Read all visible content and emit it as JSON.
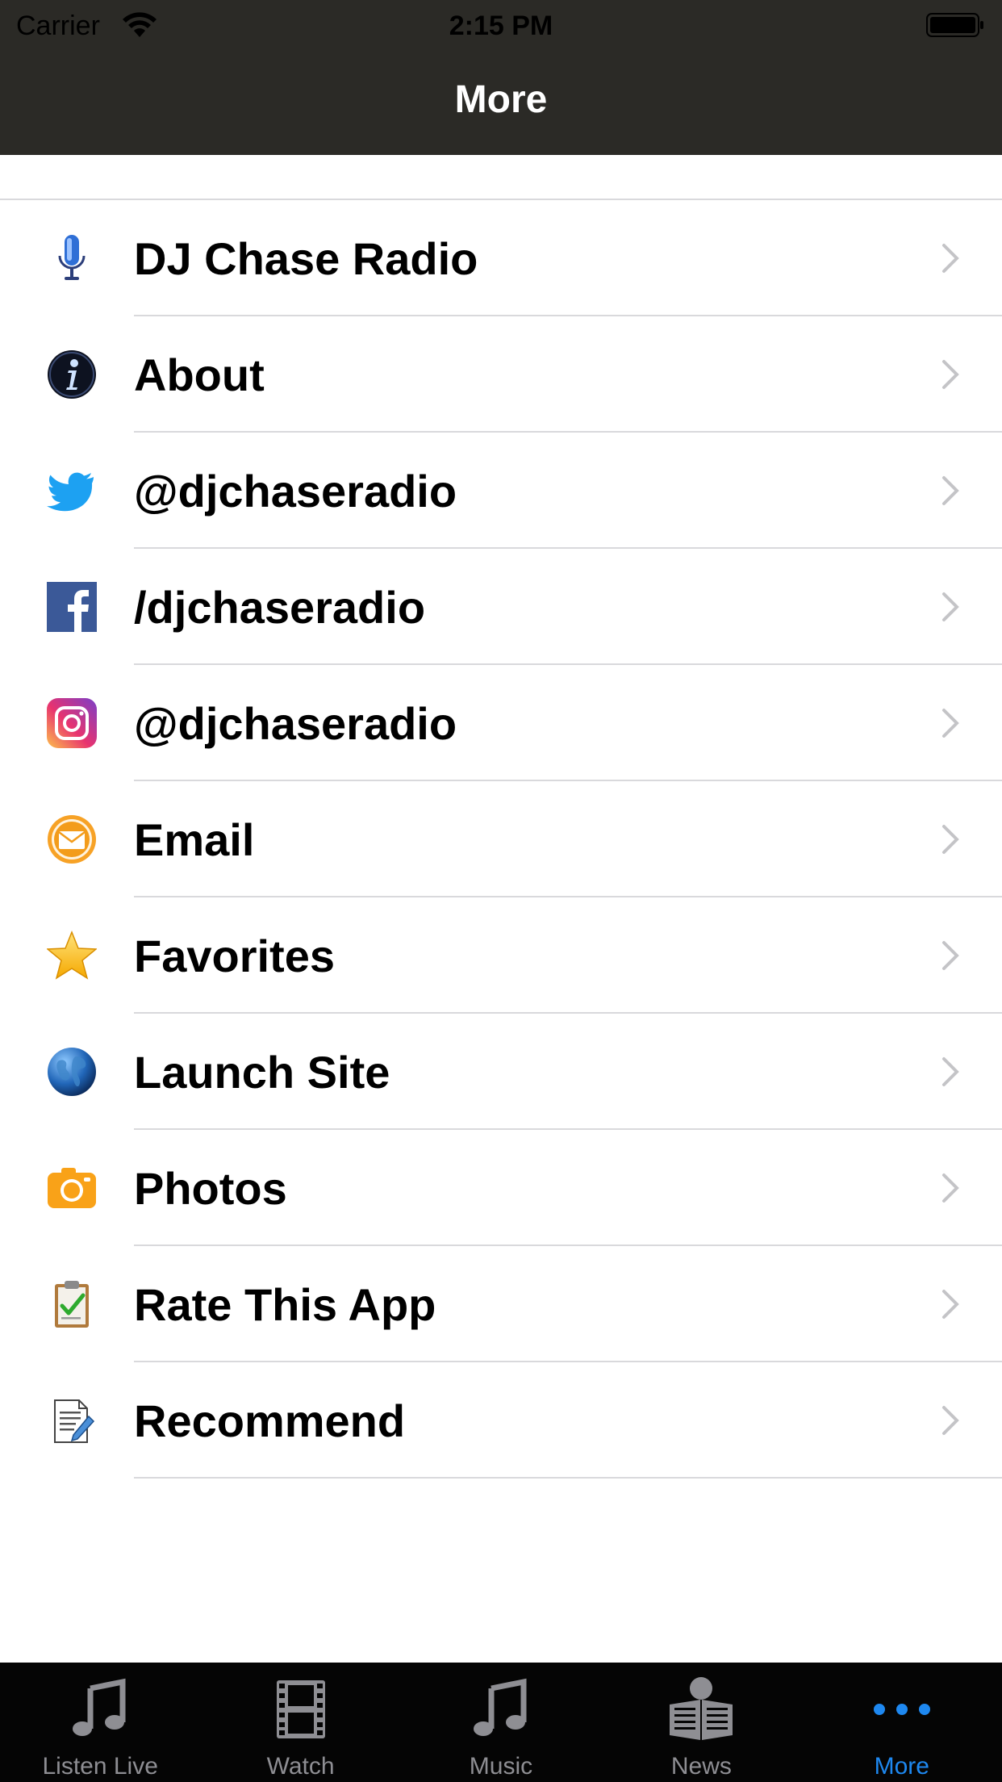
{
  "status_bar": {
    "carrier": "Carrier",
    "time": "2:15 PM",
    "wifi_icon": "wifi-icon",
    "battery_icon": "battery-icon"
  },
  "nav": {
    "title": "More"
  },
  "list": {
    "items": [
      {
        "label": "DJ Chase Radio",
        "icon": "microphone-icon"
      },
      {
        "label": "About",
        "icon": "info-icon"
      },
      {
        "label": "@djchaseradio",
        "icon": "twitter-icon"
      },
      {
        "label": "/djchaseradio",
        "icon": "facebook-icon"
      },
      {
        "label": "@djchaseradio",
        "icon": "instagram-icon"
      },
      {
        "label": "Email",
        "icon": "email-icon"
      },
      {
        "label": "Favorites",
        "icon": "star-icon"
      },
      {
        "label": "Launch Site",
        "icon": "globe-icon"
      },
      {
        "label": "Photos",
        "icon": "camera-icon"
      },
      {
        "label": "Rate This App",
        "icon": "clipboard-icon"
      },
      {
        "label": "Recommend",
        "icon": "document-icon"
      }
    ]
  },
  "tabbar": {
    "tabs": [
      {
        "label": "Listen Live",
        "icon": "music-note-icon",
        "active": false
      },
      {
        "label": "Watch",
        "icon": "film-icon",
        "active": false
      },
      {
        "label": "Music",
        "icon": "music-note-icon",
        "active": false
      },
      {
        "label": "News",
        "icon": "newspaper-icon",
        "active": false
      },
      {
        "label": "More",
        "icon": "more-dots-icon",
        "active": true
      }
    ],
    "active_color": "#1e88f0",
    "inactive_color": "#8e8e93"
  },
  "colors": {
    "nav_background": "#2b2a26",
    "tabbar_background": "#050505",
    "separator": "#d9d9dc"
  }
}
